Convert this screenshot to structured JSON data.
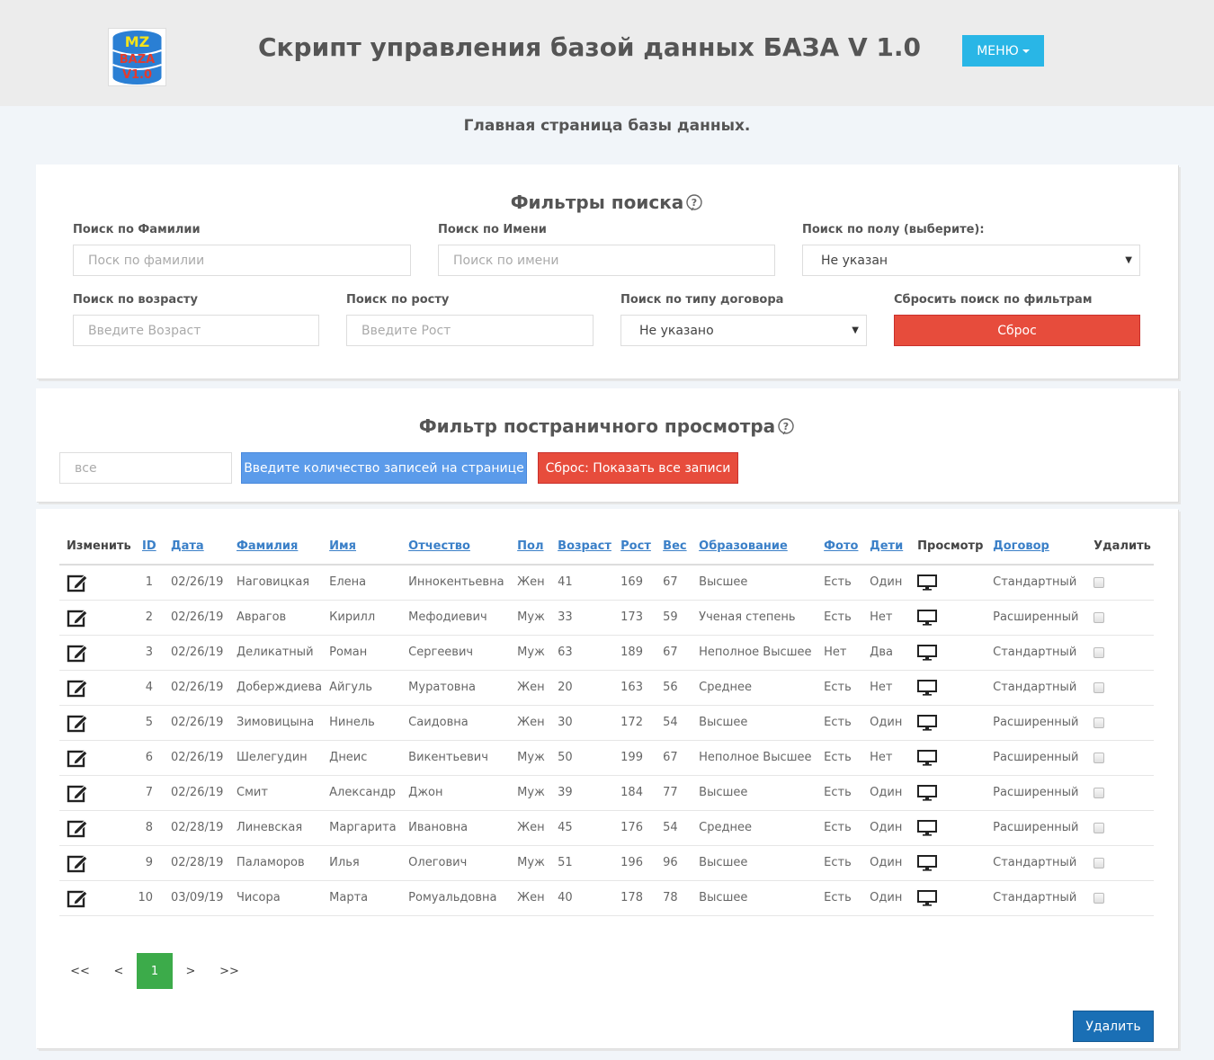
{
  "header": {
    "logo_text": "MZ BAZA V1.0",
    "title": "Скрипт управления базой данных БАЗА V 1.0",
    "menu_label": "МЕНЮ"
  },
  "subtitle": "Главная страница базы данных.",
  "search_filters": {
    "title": "Фильтры поиска",
    "surname": {
      "label": "Поиск по Фамилии",
      "placeholder": "Поск по фамилии"
    },
    "name": {
      "label": "Поиск по Имени",
      "placeholder": "Поиск по имени"
    },
    "gender": {
      "label": "Поиск по полу (выберите):",
      "value": "Не указан"
    },
    "age": {
      "label": "Поиск по возрасту",
      "placeholder": "Введите Возраст"
    },
    "height": {
      "label": "Поиск по росту",
      "placeholder": "Введите Рост"
    },
    "contract": {
      "label": "Поиск по типу договора",
      "value": "Не указано"
    },
    "reset": {
      "label": "Сбросить поиск по фильтрам",
      "button": "Сброс"
    }
  },
  "paging_filter": {
    "title": "Фильтр постраничного просмотра",
    "count_placeholder": "все",
    "apply_button": "Введите количество записей на странице",
    "reset_button": "Сброс: Показать все записи"
  },
  "table": {
    "headers": {
      "edit": "Изменить",
      "id": "ID",
      "date": "Дата",
      "surname": "Фамилия",
      "name": "Имя",
      "patronymic": "Отчество",
      "gender": "Пол",
      "age": "Возраст",
      "height": "Рост",
      "weight": "Вес",
      "education": "Образование",
      "photo": "Фото",
      "children": "Дети",
      "view": "Просмотр",
      "contract": "Договор",
      "delete": "Удалить"
    },
    "rows": [
      {
        "id": "1",
        "date": "02/26/19",
        "surname": "Наговицкая",
        "name": "Елена",
        "patronymic": "Иннокентьевна",
        "gender": "Жен",
        "age": "41",
        "height": "169",
        "weight": "67",
        "education": "Высшее",
        "photo": "Есть",
        "children": "Один",
        "contract": "Стандартный"
      },
      {
        "id": "2",
        "date": "02/26/19",
        "surname": "Аврагов",
        "name": "Кирилл",
        "patronymic": "Мефодиевич",
        "gender": "Муж",
        "age": "33",
        "height": "173",
        "weight": "59",
        "education": "Ученая степень",
        "photo": "Есть",
        "children": "Нет",
        "contract": "Расширенный"
      },
      {
        "id": "3",
        "date": "02/26/19",
        "surname": "Деликатный",
        "name": "Роман",
        "patronymic": "Сергеевич",
        "gender": "Муж",
        "age": "63",
        "height": "189",
        "weight": "67",
        "education": "Неполное Высшее",
        "photo": "Нет",
        "children": "Два",
        "contract": "Стандартный"
      },
      {
        "id": "4",
        "date": "02/26/19",
        "surname": "Доберждиева",
        "name": "Айгуль",
        "patronymic": "Муратовна",
        "gender": "Жен",
        "age": "20",
        "height": "163",
        "weight": "56",
        "education": "Среднее",
        "photo": "Есть",
        "children": "Нет",
        "contract": "Стандартный"
      },
      {
        "id": "5",
        "date": "02/26/19",
        "surname": "Зимовицына",
        "name": "Нинель",
        "patronymic": "Саидовна",
        "gender": "Жен",
        "age": "30",
        "height": "172",
        "weight": "54",
        "education": "Высшее",
        "photo": "Есть",
        "children": "Один",
        "contract": "Расширенный"
      },
      {
        "id": "6",
        "date": "02/26/19",
        "surname": "Шелегудин",
        "name": "Днеис",
        "patronymic": "Викентьевич",
        "gender": "Муж",
        "age": "50",
        "height": "199",
        "weight": "67",
        "education": "Неполное Высшее",
        "photo": "Есть",
        "children": "Нет",
        "contract": "Расширенный"
      },
      {
        "id": "7",
        "date": "02/26/19",
        "surname": "Смит",
        "name": "Александр",
        "patronymic": "Джон",
        "gender": "Муж",
        "age": "39",
        "height": "184",
        "weight": "77",
        "education": "Высшее",
        "photo": "Есть",
        "children": "Один",
        "contract": "Расширенный"
      },
      {
        "id": "8",
        "date": "02/28/19",
        "surname": "Линевская",
        "name": "Маргарита",
        "patronymic": "Ивановна",
        "gender": "Жен",
        "age": "45",
        "height": "176",
        "weight": "54",
        "education": "Среднее",
        "photo": "Есть",
        "children": "Один",
        "contract": "Расширенный"
      },
      {
        "id": "9",
        "date": "02/28/19",
        "surname": "Паламоров",
        "name": "Илья",
        "patronymic": "Олегович",
        "gender": "Муж",
        "age": "51",
        "height": "196",
        "weight": "96",
        "education": "Высшее",
        "photo": "Есть",
        "children": "Один",
        "contract": "Стандартный"
      },
      {
        "id": "10",
        "date": "03/09/19",
        "surname": "Чисора",
        "name": "Марта",
        "patronymic": "Ромуальдовна",
        "gender": "Жен",
        "age": "40",
        "height": "178",
        "weight": "78",
        "education": "Высшее",
        "photo": "Есть",
        "children": "Один",
        "contract": "Стандартный"
      }
    ]
  },
  "pagination": {
    "first": "<<",
    "prev": "<",
    "current": "1",
    "next": ">",
    "last": ">>"
  },
  "delete_button": "Удалить"
}
